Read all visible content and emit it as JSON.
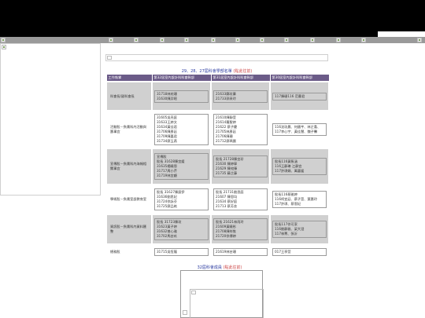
{
  "header": {
    "nav_items": [
      {
        "icon": "broken-image-icon"
      },
      {
        "icon": "broken-image-icon"
      },
      {
        "icon": "broken-image-icon"
      },
      {
        "icon": "broken-image-icon"
      },
      {
        "icon": "broken-image-icon"
      },
      {
        "icon": "broken-image-icon"
      },
      {
        "icon": "broken-image-icon"
      },
      {
        "icon": "broken-image-icon"
      },
      {
        "icon": "broken-image-icon"
      },
      {
        "icon": "broken-image-icon"
      },
      {
        "icon": "broken-image-icon"
      },
      {
        "icon": "broken-image-icon"
      },
      {
        "icon": "broken-image-icon"
      }
    ]
  },
  "main": {
    "table_title": "29、28、27屆科會學部名單",
    "table_title_link": "(點此往前)",
    "columns": [
      "工作執掌",
      "第32屆室內設計科科會幹部",
      "第31屆室內設計科科會幹部",
      "第30屆室內設計科科會幹部"
    ],
    "rows": [
      {
        "role": "科會長/副科會長",
        "c32": [
          "31718林宛珊",
          "31630陳羿暄"
        ],
        "c31": [
          "21633鄭玟蓁",
          "21733郭采玲"
        ],
        "c30": [
          "117陳珊116 范曹君"
        ]
      },
      {
        "role": "活動股－負責科內活動與籌事宜",
        "c32": [
          "31605吳亮庭",
          "31633王婷文",
          "31634黃佳君",
          "31706陳彥廷",
          "31709陳嘉君",
          "31734廖玉燕"
        ],
        "c31": [
          "21610陳靜萱",
          "21614羅聖婷",
          "21622 蔡子慶",
          "21705林彥廷",
          "21706陳珊",
          "21712廖珮晨"
        ],
        "c30": [
          "116沈玟晨、何國芊、林芷喬、",
          "117李心宇、黃佳慧、魏子馨"
        ]
      },
      {
        "role": "宣傳股－負責科內海報相關事宜",
        "c32": [
          "宣傳股",
          "股長 31628陳宜媛",
          "31635楊曉恩",
          "31717周小芹",
          "31719林宜顧"
        ],
        "c31": [
          "股長 21728陳宜珍",
          "21630 陳婷寧",
          "21629 陳宛臻",
          "21735 蘇芷藤"
        ],
        "c30": [
          "股長116黃筱涵",
          "116王靜琳 江靜宜",
          "117許琪娟、萬藝媛"
        ]
      },
      {
        "role": "學術股－負責室設教育室",
        "c32": [
          "股長 31627陳宸伊",
          "31636劉思妃",
          "31724徐詠芬",
          "31725廖品筑"
        ],
        "c31": [
          "股長 21731劉思庭",
          "21607 陳思均",
          "21634 蔡好庭",
          "21713 蔡芳芸"
        ],
        "c30": [
          "股長116蔡雅婷",
          "116柯宜廷、蔡子萱、葉惠玲",
          "117許琪、蔡恩妃"
        ]
      },
      {
        "role": "資訊股－負責科內資料匯整",
        "c32": [
          "股長 31723陳玟",
          "31623黃子婷",
          "31632曾心雅",
          "31702馬芸玖"
        ],
        "c31": [
          "股長 21621林雨玲",
          "21609黃曉彤",
          "21708陳祥惟",
          "21720徐傳婷"
        ],
        "c30": [
          "股長117徐可家",
          "116劉靜雅、梁大澄",
          "117林菁、張沂"
        ]
      },
      {
        "role": "總務股",
        "c32": [
          "31715吳恆龍"
        ],
        "c31": [
          "21619林芸珊"
        ],
        "c30": [
          "017王亭萱"
        ]
      }
    ],
    "footer_link": "32屆科會成員",
    "footer_link_hint": "(點此往前)"
  }
}
